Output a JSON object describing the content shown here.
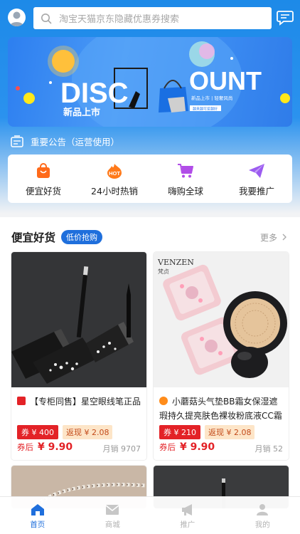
{
  "search": {
    "placeholder": "淘宝天猫京东隐藏优惠券搜索"
  },
  "banner": {
    "big_text": "DISC",
    "big_text_2": "OUNT",
    "tagline": "新品上市",
    "small_text": "新品上市 | 轻奢风尚",
    "small_text_2": "越来越可爱越好"
  },
  "notice": {
    "text": "重要公告（运营使用）"
  },
  "categories": [
    {
      "label": "便宜好货",
      "icon": "shopping-bag-icon",
      "color": "#ff6a1a"
    },
    {
      "label": "24小时热销",
      "icon": "hot-icon",
      "color": "#ff7a1a"
    },
    {
      "label": "嗨购全球",
      "icon": "cart-icon",
      "color": "#b14de8"
    },
    {
      "label": "我要推广",
      "icon": "paper-plane-icon",
      "color": "#9c5cf0"
    }
  ],
  "section": {
    "title": "便宜好货",
    "badge": "低价抢购",
    "more": "更多"
  },
  "products": [
    {
      "title": "【专柜同售】星空眼线笔正品",
      "source_color": "#e32227",
      "coupon": "券 ¥ 400",
      "rebate": "返现 ¥ 2.08",
      "price_label": "券后",
      "price": "¥  9.90",
      "sales": "月销 9707"
    },
    {
      "title": "小蘑菇头气垫BB霜女保湿遮瑕持久提亮肤色裸妆粉底液CC霜",
      "source_color": "#ff8c1a",
      "brand": "VENZEN",
      "brand_cn": "梵贞",
      "coupon": "券 ¥ 210",
      "rebate": "返现 ¥ 2.08",
      "price_label": "券后",
      "price": "¥  9.90",
      "sales": "月销 52"
    }
  ],
  "tabs": [
    {
      "label": "首页",
      "icon": "home-icon",
      "active": true
    },
    {
      "label": "商城",
      "icon": "mail-icon",
      "active": false
    },
    {
      "label": "推广",
      "icon": "megaphone-icon",
      "active": false
    },
    {
      "label": "我的",
      "icon": "user-icon",
      "active": false
    }
  ],
  "colors": {
    "primary": "#1f6fdc",
    "price_red": "#e32227",
    "rebate_bg": "#fde5c8"
  }
}
